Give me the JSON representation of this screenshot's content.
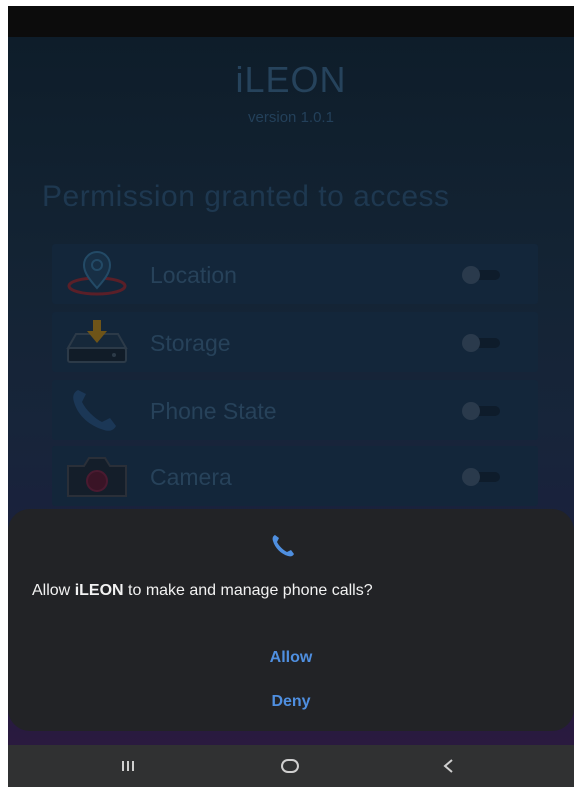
{
  "app": {
    "title": "iLEON",
    "version": "version 1.0.1"
  },
  "permissions": {
    "heading": "Permission granted to access",
    "items": [
      {
        "label": "Location",
        "icon": "location-pin-icon",
        "enabled": false
      },
      {
        "label": "Storage",
        "icon": "storage-download-icon",
        "enabled": false
      },
      {
        "label": "Phone State",
        "icon": "phone-icon",
        "enabled": false
      },
      {
        "label": "Camera",
        "icon": "camera-icon",
        "enabled": false
      }
    ]
  },
  "dialog": {
    "icon": "phone-icon",
    "message_prefix": "Allow ",
    "app_name": "iLEON",
    "message_suffix": " to make and manage phone calls?",
    "allow_label": "Allow",
    "deny_label": "Deny",
    "accent_color": "#4f8fe0"
  },
  "nav": {
    "recents": "recents-icon",
    "home": "home-icon",
    "back": "back-icon"
  }
}
